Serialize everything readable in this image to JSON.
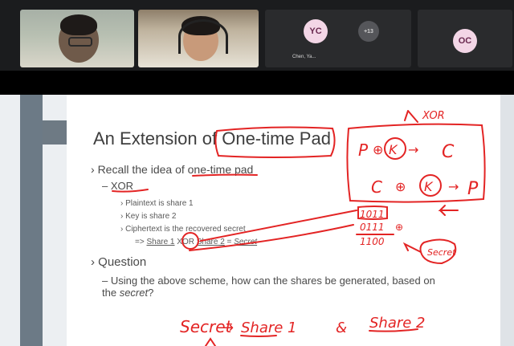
{
  "meeting": {
    "participants": [
      {
        "initials": "YC",
        "name": "Chen, Ya..."
      },
      {
        "initials": "+13"
      },
      {
        "initials": "OC"
      }
    ]
  },
  "slide": {
    "title_prefix": "An Extension of ",
    "title_boxed": "One-time Pad",
    "bullet1": "Recall the idea of one-time pad",
    "sub_xor": "XOR",
    "items": [
      "Plaintext is share 1",
      "Key is share 2",
      "Ciphertext is the recovered secret"
    ],
    "formula": {
      "arrow": "=>",
      "share1": "Share 1",
      "op": "XOR",
      "share2": "Share 2",
      "eq": "=",
      "secret": "Secret"
    },
    "question_label": "Question",
    "question_text_part1": "Using the above scheme, how can the shares be generated, based on the ",
    "question_text_italic": "secret",
    "question_text_end": "?"
  },
  "annotations": {
    "xor_note": "XOR",
    "eq1": {
      "p": "P",
      "op": "⊕",
      "k": "K",
      "arrow": "→",
      "c": "C"
    },
    "eq2": {
      "c": "C",
      "op": "⊕",
      "k": "K",
      "arrow": "→",
      "p": "P"
    },
    "bits": [
      "1011",
      "0111",
      "1100"
    ],
    "xor_circle": "⊕",
    "secret_note": "Secret",
    "bottom": {
      "secret": "Secret",
      "arrow": "→",
      "share1": "Share 1",
      "amp": "&",
      "share2": "Share 2"
    }
  },
  "colors": {
    "ink": "#e32424",
    "topbar": "#1b1c1e",
    "avatar_bg": "#f3d6e6"
  }
}
